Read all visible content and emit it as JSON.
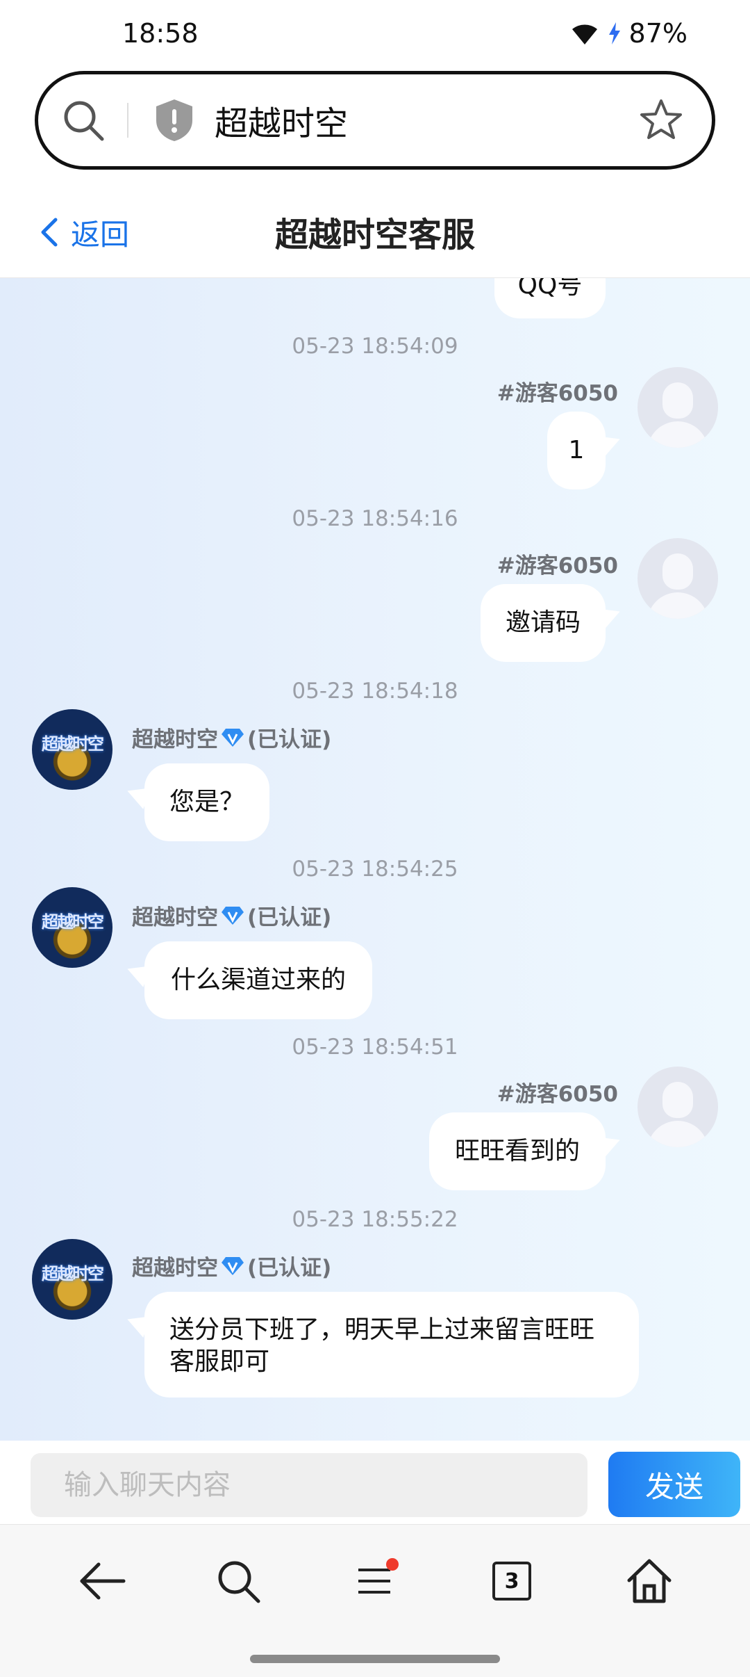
{
  "status_bar": {
    "time": "18:58",
    "battery": "87%"
  },
  "address_bar": {
    "title": "超越时空"
  },
  "header": {
    "back_label": "返回",
    "title": "超越时空客服"
  },
  "chat": {
    "partial_top_message": "QQ号",
    "messages": [
      {
        "timestamp": "05-23 18:54:09",
        "side": "right",
        "sender": "#游客6050",
        "text": "1"
      },
      {
        "timestamp": "05-23 18:54:16",
        "side": "right",
        "sender": "#游客6050",
        "text": "邀请码"
      },
      {
        "timestamp": "05-23 18:54:18",
        "side": "left",
        "sender": "超越时空",
        "verified_label": "(已认证)",
        "text": "您是？"
      },
      {
        "timestamp": "05-23 18:54:25",
        "side": "left",
        "sender": "超越时空",
        "verified_label": "(已认证)",
        "text": "什么渠道过来的"
      },
      {
        "timestamp": "05-23 18:54:51",
        "side": "right",
        "sender": "#游客6050",
        "text": "旺旺看到的"
      },
      {
        "timestamp": "05-23 18:55:22",
        "side": "left",
        "sender": "超越时空",
        "verified_label": "(已认证)",
        "text_line1": "送分员下班了，明天早上过来留言旺旺",
        "text_line2": "客服即可"
      }
    ],
    "service_avatar_text": "超越时空"
  },
  "input_bar": {
    "placeholder": "输入聊天内容",
    "send_label": "发送"
  },
  "bottom_nav": {
    "tab_count": "3"
  },
  "colors": {
    "accent": "#1a73e8",
    "send_gradient_start": "#1f7bf2",
    "send_gradient_end": "#3fb5f8",
    "notification_dot": "#ef3b2c"
  }
}
